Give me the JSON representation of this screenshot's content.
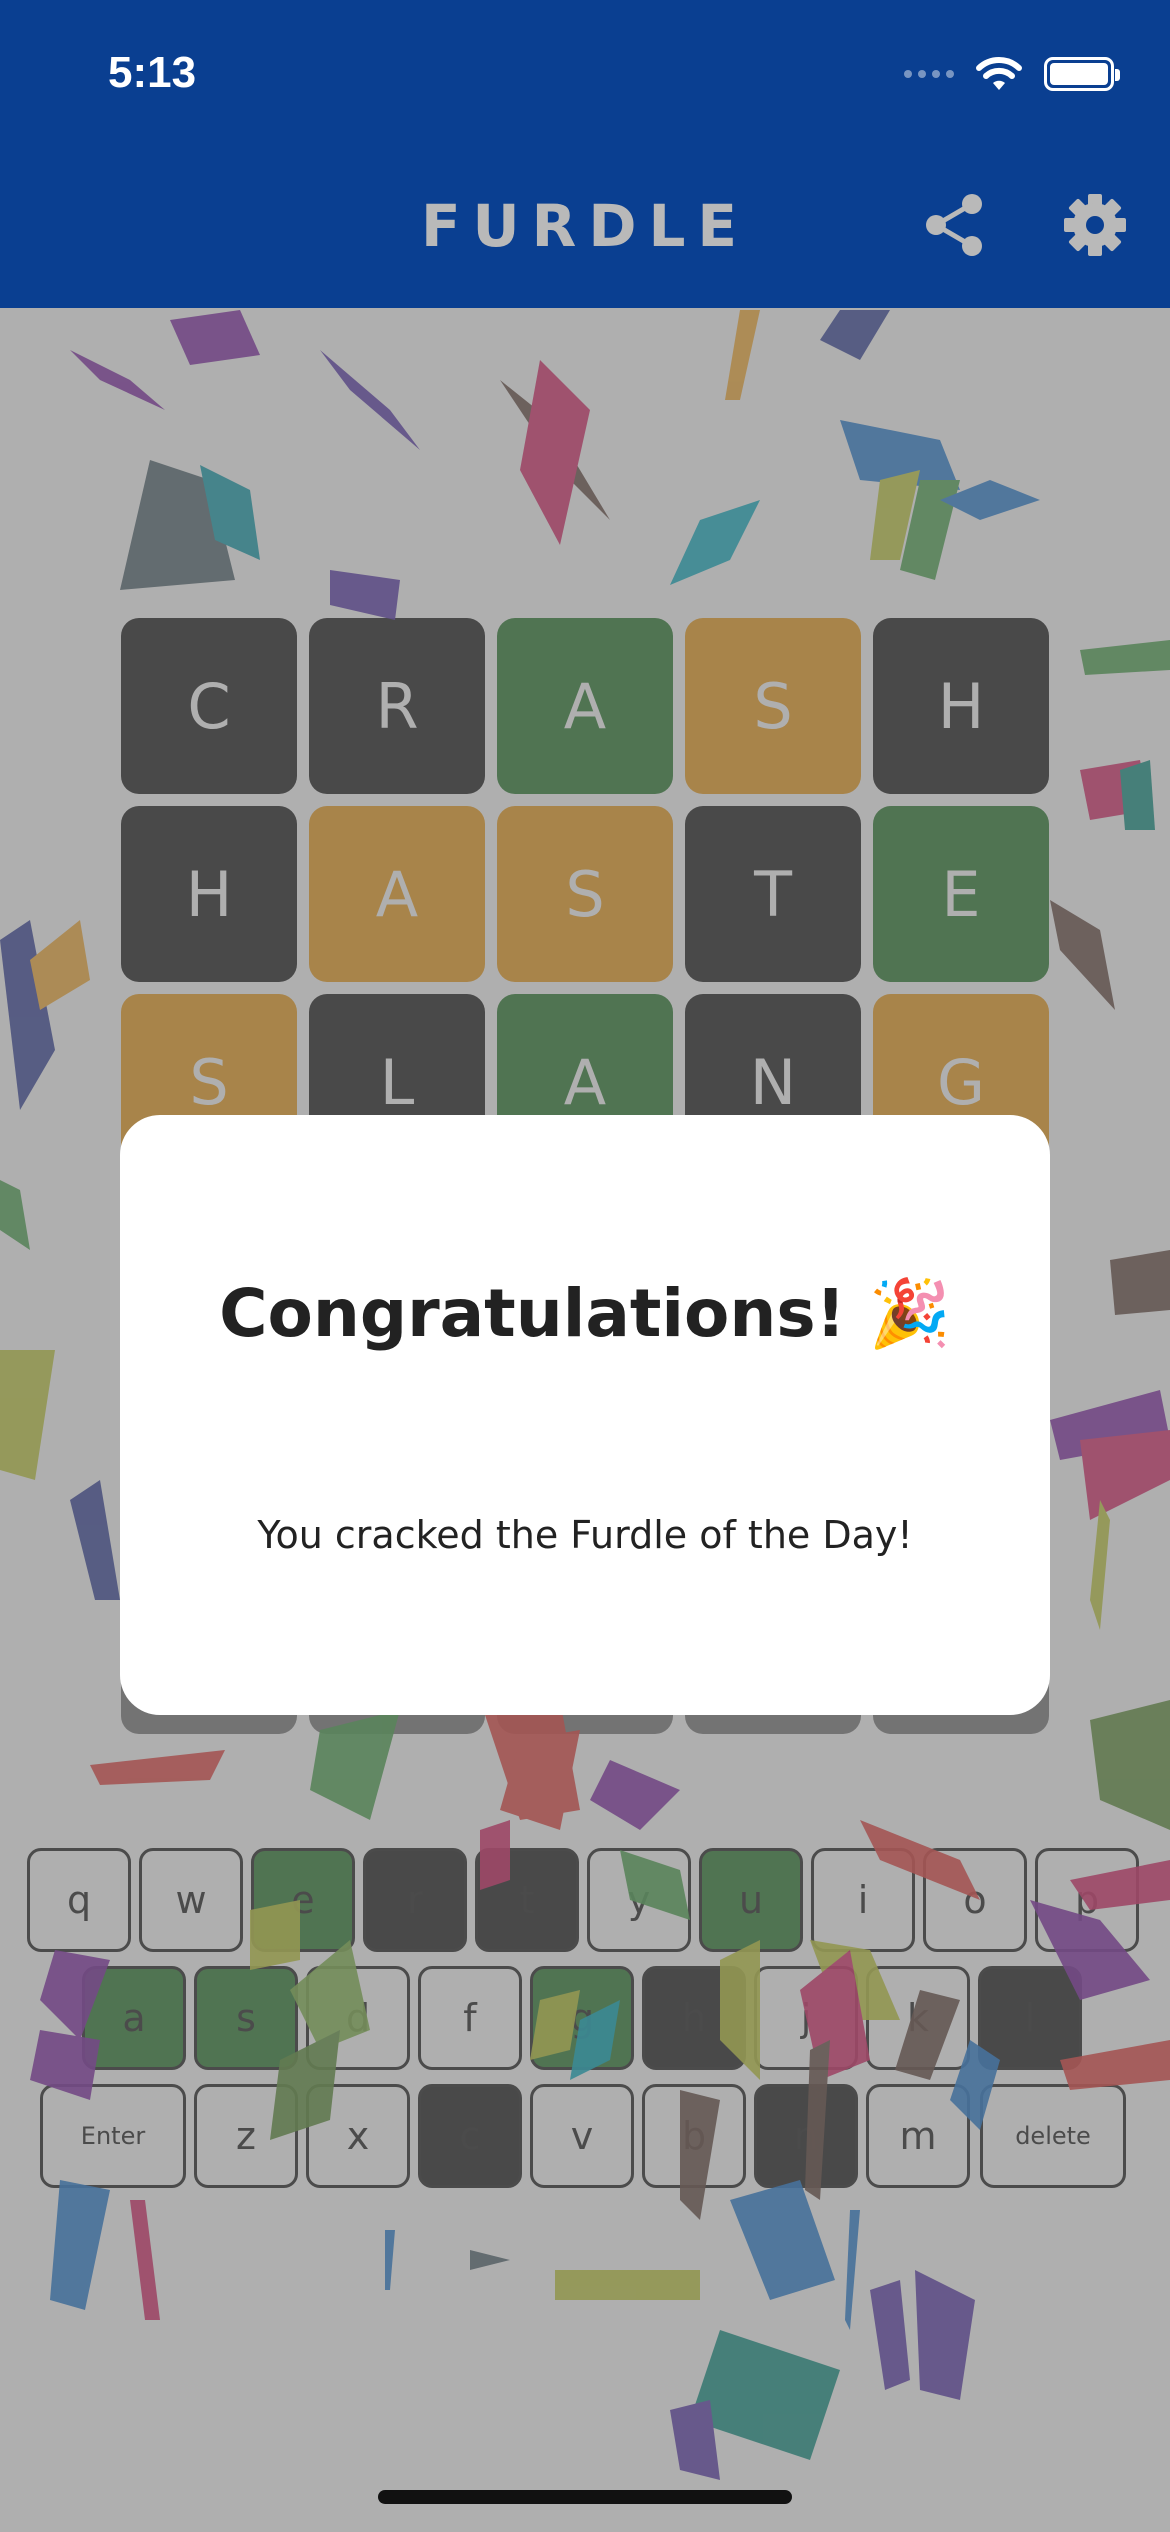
{
  "status_bar": {
    "time": "5:13"
  },
  "header": {
    "title": "FURDLE",
    "share_icon": "share-icon",
    "settings_icon": "gear-icon",
    "background_color": "#0a3f91"
  },
  "board": {
    "rows": [
      [
        {
          "letter": "C",
          "state": "absent"
        },
        {
          "letter": "R",
          "state": "absent"
        },
        {
          "letter": "A",
          "state": "correct"
        },
        {
          "letter": "S",
          "state": "present"
        },
        {
          "letter": "H",
          "state": "absent"
        }
      ],
      [
        {
          "letter": "H",
          "state": "absent"
        },
        {
          "letter": "A",
          "state": "present"
        },
        {
          "letter": "S",
          "state": "present"
        },
        {
          "letter": "T",
          "state": "absent"
        },
        {
          "letter": "E",
          "state": "correct"
        }
      ],
      [
        {
          "letter": "S",
          "state": "present"
        },
        {
          "letter": "L",
          "state": "absent"
        },
        {
          "letter": "A",
          "state": "correct"
        },
        {
          "letter": "N",
          "state": "absent"
        },
        {
          "letter": "G",
          "state": "present"
        }
      ]
    ],
    "colors": {
      "correct": "#2e7d32",
      "present": "#f0a020",
      "absent": "#1e1e1e"
    }
  },
  "keyboard": {
    "rows": [
      [
        {
          "label": "q",
          "state": "unused"
        },
        {
          "label": "w",
          "state": "unused"
        },
        {
          "label": "e",
          "state": "correct"
        },
        {
          "label": "r",
          "state": "absent"
        },
        {
          "label": "t",
          "state": "absent"
        },
        {
          "label": "y",
          "state": "unused"
        },
        {
          "label": "u",
          "state": "correct"
        },
        {
          "label": "i",
          "state": "unused"
        },
        {
          "label": "o",
          "state": "unused"
        },
        {
          "label": "p",
          "state": "unused"
        }
      ],
      [
        {
          "label": "a",
          "state": "correct"
        },
        {
          "label": "s",
          "state": "correct"
        },
        {
          "label": "d",
          "state": "unused"
        },
        {
          "label": "f",
          "state": "unused"
        },
        {
          "label": "g",
          "state": "correct"
        },
        {
          "label": "h",
          "state": "absent"
        },
        {
          "label": "j",
          "state": "unused"
        },
        {
          "label": "k",
          "state": "unused"
        },
        {
          "label": "l",
          "state": "absent"
        }
      ],
      [
        {
          "label": "Enter",
          "state": "unused"
        },
        {
          "label": "z",
          "state": "unused"
        },
        {
          "label": "x",
          "state": "unused"
        },
        {
          "label": "c",
          "state": "absent"
        },
        {
          "label": "v",
          "state": "unused"
        },
        {
          "label": "b",
          "state": "unused"
        },
        {
          "label": "n",
          "state": "absent"
        },
        {
          "label": "m",
          "state": "unused"
        },
        {
          "label": "delete",
          "state": "unused"
        }
      ]
    ]
  },
  "dialog": {
    "title": "Congratulations! 🎉",
    "message": "You cracked the Furdle of the Day!"
  }
}
